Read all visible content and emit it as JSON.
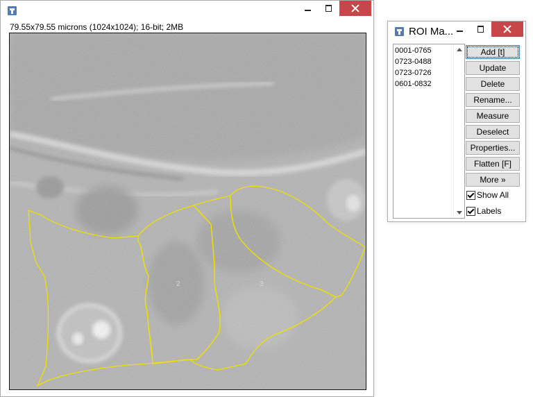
{
  "image_window": {
    "title": "",
    "info": "79.55x79.55 microns (1024x1024); 16-bit; 2MB",
    "roi_labels": [
      "2",
      "3"
    ]
  },
  "roi_manager": {
    "title": "ROI Ma...",
    "items": [
      "0001-0765",
      "0723-0488",
      "0723-0726",
      "0601-0832"
    ],
    "buttons": {
      "add": "Add [t]",
      "update": "Update",
      "delete": "Delete",
      "rename": "Rename...",
      "measure": "Measure",
      "deselect": "Deselect",
      "properties": "Properties...",
      "flatten": "Flatten [F]",
      "more": "More »"
    },
    "show_all": {
      "label": "Show All",
      "checked": true
    },
    "labels": {
      "label": "Labels",
      "checked": true
    }
  },
  "colors": {
    "roi_outline": "#f0e000",
    "close_button": "#c7464a",
    "app_icon": "#4f7bbf"
  }
}
